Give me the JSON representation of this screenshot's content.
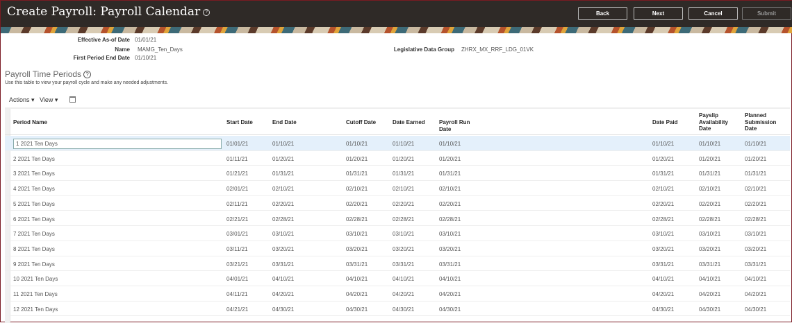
{
  "header": {
    "title": "Create Payroll: Payroll Calendar",
    "help": "?",
    "buttons": {
      "back": "Back",
      "next": "Next",
      "cancel": "Cancel",
      "submit": "Submit"
    }
  },
  "details": {
    "effective_label": "Effective As-of Date",
    "effective_value": "01/01/21",
    "name_label": "Name",
    "name_value": "MAMG_Ten_Days",
    "first_label": "First Period End Date",
    "first_value": "01/10/21",
    "ldg_label": "Legislative Data Group",
    "ldg_value": "ZHRX_MX_RRF_LDG_01VK"
  },
  "section": {
    "title": "Payroll Time Periods",
    "help": "?",
    "description": "Use this table to view your payroll cycle and make any needed adjustments."
  },
  "toolbar": {
    "actions": "Actions ▾",
    "view": "View ▾",
    "detach_icon": "detach-icon"
  },
  "table": {
    "columns": [
      "Period Name",
      "Start Date",
      "End Date",
      "Cutoff Date",
      "Date Earned",
      "Payroll Run Date",
      "Date Paid",
      "Payslip Availability Date",
      "Planned Submission Date"
    ],
    "rows": [
      [
        "1 2021 Ten Days",
        "01/01/21",
        "01/10/21",
        "01/10/21",
        "01/10/21",
        "01/10/21",
        "01/10/21",
        "01/10/21",
        "01/10/21"
      ],
      [
        "2 2021 Ten Days",
        "01/11/21",
        "01/20/21",
        "01/20/21",
        "01/20/21",
        "01/20/21",
        "01/20/21",
        "01/20/21",
        "01/20/21"
      ],
      [
        "3 2021 Ten Days",
        "01/21/21",
        "01/31/21",
        "01/31/21",
        "01/31/21",
        "01/31/21",
        "01/31/21",
        "01/31/21",
        "01/31/21"
      ],
      [
        "4 2021 Ten Days",
        "02/01/21",
        "02/10/21",
        "02/10/21",
        "02/10/21",
        "02/10/21",
        "02/10/21",
        "02/10/21",
        "02/10/21"
      ],
      [
        "5 2021 Ten Days",
        "02/11/21",
        "02/20/21",
        "02/20/21",
        "02/20/21",
        "02/20/21",
        "02/20/21",
        "02/20/21",
        "02/20/21"
      ],
      [
        "6 2021 Ten Days",
        "02/21/21",
        "02/28/21",
        "02/28/21",
        "02/28/21",
        "02/28/21",
        "02/28/21",
        "02/28/21",
        "02/28/21"
      ],
      [
        "7 2021 Ten Days",
        "03/01/21",
        "03/10/21",
        "03/10/21",
        "03/10/21",
        "03/10/21",
        "03/10/21",
        "03/10/21",
        "03/10/21"
      ],
      [
        "8 2021 Ten Days",
        "03/11/21",
        "03/20/21",
        "03/20/21",
        "03/20/21",
        "03/20/21",
        "03/20/21",
        "03/20/21",
        "03/20/21"
      ],
      [
        "9 2021 Ten Days",
        "03/21/21",
        "03/31/21",
        "03/31/21",
        "03/31/21",
        "03/31/21",
        "03/31/21",
        "03/31/21",
        "03/31/21"
      ],
      [
        "10 2021 Ten Days",
        "04/01/21",
        "04/10/21",
        "04/10/21",
        "04/10/21",
        "04/10/21",
        "04/10/21",
        "04/10/21",
        "04/10/21"
      ],
      [
        "11 2021 Ten Days",
        "04/11/21",
        "04/20/21",
        "04/20/21",
        "04/20/21",
        "04/20/21",
        "04/20/21",
        "04/20/21",
        "04/20/21"
      ],
      [
        "12 2021 Ten Days",
        "04/21/21",
        "04/30/21",
        "04/30/21",
        "04/30/21",
        "04/30/21",
        "04/30/21",
        "04/30/21",
        "04/30/21"
      ]
    ]
  }
}
